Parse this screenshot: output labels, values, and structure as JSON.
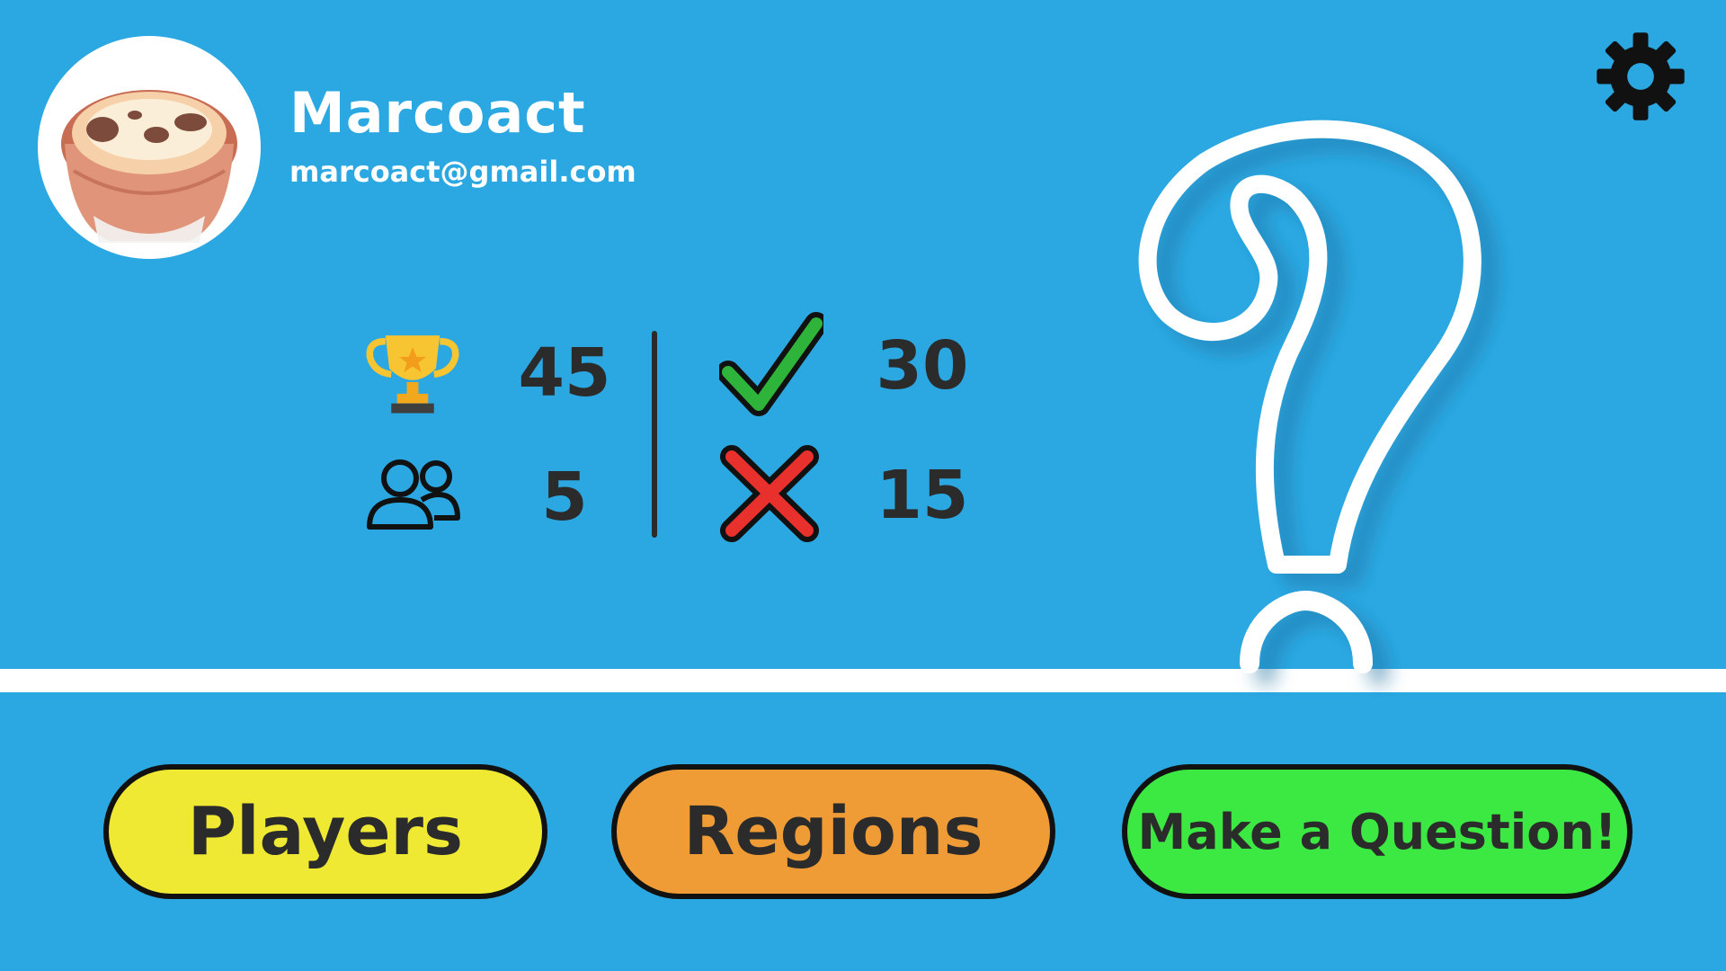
{
  "profile": {
    "username": "Marcoact",
    "email": "marcoact@gmail.com",
    "avatar_icon": "custard-tart-avatar"
  },
  "settings": {
    "icon": "gear-icon"
  },
  "stats": {
    "trophies": {
      "icon": "trophy-icon",
      "value": "45"
    },
    "friends": {
      "icon": "users-icon",
      "value": "5"
    },
    "correct": {
      "icon": "checkmark-icon",
      "value": "30"
    },
    "wrong": {
      "icon": "cross-icon",
      "value": "15"
    }
  },
  "buttons": {
    "players": "Players",
    "regions": "Regions",
    "make_question": "Make a Question!"
  },
  "colors": {
    "background": "#2ba8e2",
    "players": "#efe934",
    "regions": "#ef9b36",
    "make_question": "#3ce943"
  }
}
